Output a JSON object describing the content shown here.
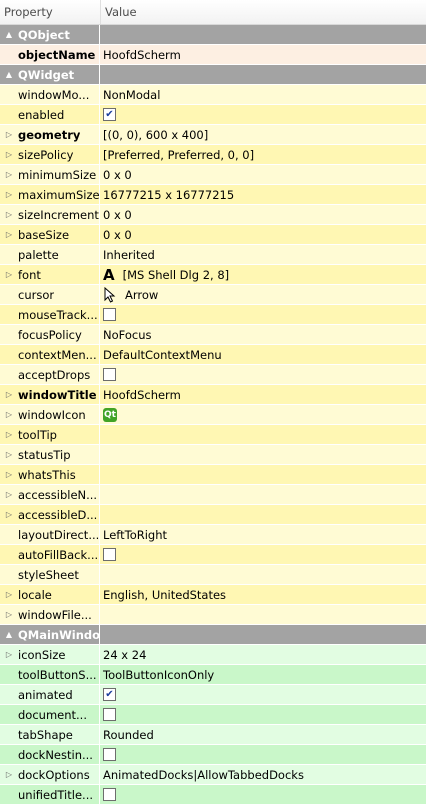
{
  "header": {
    "property": "Property",
    "value": "Value"
  },
  "groups": {
    "qobject": "QObject",
    "qwidget": "QWidget",
    "qmainwindow": "QMainWindow"
  },
  "qobject": {
    "objectName": {
      "name": "objectName",
      "value": "HoofdScherm"
    }
  },
  "qwidget": {
    "windowModality": {
      "name": "windowMo...",
      "value": "NonModal"
    },
    "enabled": {
      "name": "enabled",
      "checked": true
    },
    "geometry": {
      "name": "geometry",
      "value": "[(0, 0), 600 x 400]"
    },
    "sizePolicy": {
      "name": "sizePolicy",
      "value": "[Preferred, Preferred, 0, 0]"
    },
    "minimumSize": {
      "name": "minimumSize",
      "value": "0 x 0"
    },
    "maximumSize": {
      "name": "maximumSize",
      "value": "16777215 x 16777215"
    },
    "sizeIncrement": {
      "name": "sizeIncrement",
      "value": "0 x 0"
    },
    "baseSize": {
      "name": "baseSize",
      "value": "0 x 0"
    },
    "palette": {
      "name": "palette",
      "value": "Inherited"
    },
    "font": {
      "name": "font",
      "icon": "font-icon",
      "icon_glyph": "A",
      "value": "[MS Shell Dlg 2, 8]"
    },
    "cursor": {
      "name": "cursor",
      "icon": "arrow-cursor-icon",
      "value": "Arrow"
    },
    "mouseTracking": {
      "name": "mouseTrack...",
      "checked": false
    },
    "focusPolicy": {
      "name": "focusPolicy",
      "value": "NoFocus"
    },
    "contextMenuPolicy": {
      "name": "contextMen...",
      "value": "DefaultContextMenu"
    },
    "acceptDrops": {
      "name": "acceptDrops",
      "checked": false
    },
    "windowTitle": {
      "name": "windowTitle",
      "value": "HoofdScherm"
    },
    "windowIcon": {
      "name": "windowIcon",
      "icon": "qt-icon",
      "icon_glyph": "Qt"
    },
    "toolTip": {
      "name": "toolTip",
      "value": ""
    },
    "statusTip": {
      "name": "statusTip",
      "value": ""
    },
    "whatsThis": {
      "name": "whatsThis",
      "value": ""
    },
    "accessibleName": {
      "name": "accessibleN...",
      "value": ""
    },
    "accessibleDescription": {
      "name": "accessibleD...",
      "value": ""
    },
    "layoutDirection": {
      "name": "layoutDirect...",
      "value": "LeftToRight"
    },
    "autoFillBackground": {
      "name": "autoFillBack...",
      "checked": false
    },
    "styleSheet": {
      "name": "styleSheet",
      "value": ""
    },
    "locale": {
      "name": "locale",
      "value": "English, UnitedStates"
    },
    "windowFilePath": {
      "name": "windowFile...",
      "value": ""
    }
  },
  "qmainwindow": {
    "iconSize": {
      "name": "iconSize",
      "value": "24 x 24"
    },
    "toolButtonStyle": {
      "name": "toolButtonS...",
      "value": "ToolButtonIconOnly"
    },
    "animated": {
      "name": "animated",
      "checked": true
    },
    "documentMode": {
      "name": "document...",
      "checked": false
    },
    "tabShape": {
      "name": "tabShape",
      "value": "Rounded"
    },
    "dockNesting": {
      "name": "dockNestin...",
      "checked": false
    },
    "dockOptions": {
      "name": "dockOptions",
      "value": "AnimatedDocks|AllowTabbedDocks"
    },
    "unifiedTitle": {
      "name": "unifiedTitle...",
      "checked": false
    }
  },
  "colors": {
    "group_header": "#a3a3a3",
    "qobject_row": "#fdefe2",
    "qwidget_row_light": "#fffbd4",
    "qwidget_row_dark": "#fff7b3",
    "qmainwindow_row_light": "#e2fde2",
    "qmainwindow_row_dark": "#c9f7c9",
    "checkbox_check": "#1d3f9c"
  }
}
